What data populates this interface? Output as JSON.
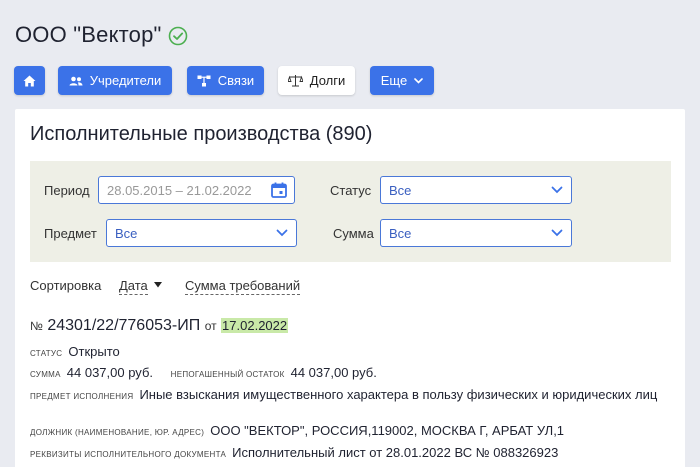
{
  "company": {
    "name": "ООО \"Вектор\""
  },
  "toolbar": {
    "founders": "Учредители",
    "links": "Связи",
    "debts": "Долги",
    "more": "Еще"
  },
  "panel": {
    "title": "Исполнительные производства (890)"
  },
  "filters": {
    "period_label": "Период",
    "period_value": "28.05.2015 – 21.02.2022",
    "status_label": "Статус",
    "status_value": "Все",
    "subject_label": "Предмет",
    "subject_value": "Все",
    "sum_label": "Сумма",
    "sum_value": "Все"
  },
  "sort": {
    "label": "Сортировка",
    "date": "Дата",
    "sum": "Сумма требований"
  },
  "case": {
    "no_prefix": "№",
    "number": "24301/22/776053-ИП",
    "from": "от",
    "date": "17.02.2022",
    "status_key": "статус",
    "status_value": "Открыто",
    "sum_key": "сумма",
    "sum_value": "44 037,00 руб.",
    "remaining_key": "непогашенный остаток",
    "remaining_value": "44 037,00 руб.",
    "subject_key": "предмет исполнения",
    "subject_value": "Иные взыскания имущественного характера в пользу физических и юридических лиц",
    "debtor_key": "должник (наименование, юр. адрес)",
    "debtor_value": "ООО \"ВЕКТОР\", РОССИЯ,119002, МОСКВА Г, АРБАТ УЛ,1",
    "doc_key": "реквизиты исполнительного документа",
    "doc_value": "Исполнительный лист от 28.01.2022 ВС № 088326923"
  },
  "colors": {
    "accent": "#3b72e8",
    "check": "#4caf50",
    "highlight": "#c9e9a8",
    "filter_bg": "#eeefe6"
  }
}
